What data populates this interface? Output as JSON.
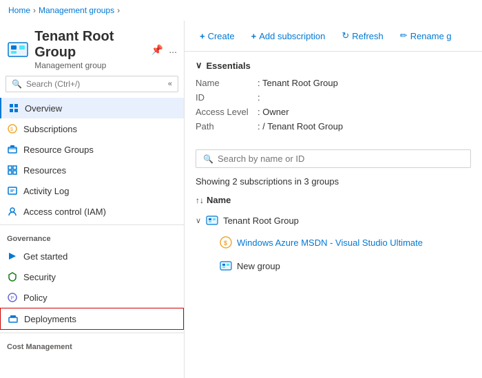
{
  "breadcrumb": {
    "items": [
      "Home",
      "Management groups"
    ]
  },
  "header": {
    "title": "Tenant Root Group",
    "subtitle": "Management group",
    "pin_label": "📌",
    "more_label": "..."
  },
  "toolbar": {
    "create_label": "Create",
    "add_subscription_label": "Add subscription",
    "refresh_label": "Refresh",
    "rename_label": "Rename g"
  },
  "sidebar": {
    "search_placeholder": "Search (Ctrl+/)",
    "collapse_label": "«",
    "nav_items": [
      {
        "id": "overview",
        "label": "Overview",
        "active": true
      },
      {
        "id": "subscriptions",
        "label": "Subscriptions",
        "active": false
      },
      {
        "id": "resource-groups",
        "label": "Resource Groups",
        "active": false
      },
      {
        "id": "resources",
        "label": "Resources",
        "active": false
      },
      {
        "id": "activity-log",
        "label": "Activity Log",
        "active": false
      },
      {
        "id": "access-control",
        "label": "Access control (IAM)",
        "active": false
      }
    ],
    "governance_label": "Governance",
    "governance_items": [
      {
        "id": "get-started",
        "label": "Get started",
        "active": false
      },
      {
        "id": "security",
        "label": "Security",
        "active": false
      },
      {
        "id": "policy",
        "label": "Policy",
        "active": false
      },
      {
        "id": "deployments",
        "label": "Deployments",
        "active": false,
        "highlighted": true
      }
    ],
    "cost_label": "Cost Management"
  },
  "essentials": {
    "title": "Essentials",
    "rows": [
      {
        "label": "Name",
        "value": "Tenant Root Group"
      },
      {
        "label": "ID",
        "value": ""
      },
      {
        "label": "Access Level",
        "value": "Owner"
      },
      {
        "label": "Path",
        "value": "/ Tenant Root Group"
      }
    ]
  },
  "content": {
    "search_placeholder": "Search by name or ID",
    "showing_text": "Showing 2 subscriptions in 3 groups",
    "name_col": "Name",
    "tree": [
      {
        "id": "tenant-root",
        "label": "Tenant Root Group",
        "type": "root",
        "children": [
          {
            "id": "azure-msdn",
            "label": "Windows Azure MSDN - Visual Studio Ultimate",
            "type": "subscription"
          },
          {
            "id": "new-group",
            "label": "New group",
            "type": "group"
          }
        ]
      }
    ]
  }
}
